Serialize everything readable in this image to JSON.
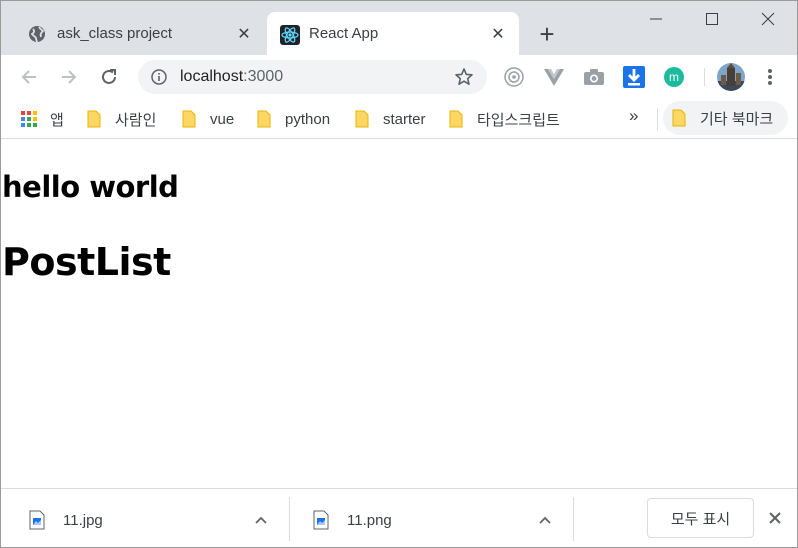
{
  "tabs": [
    {
      "title": "ask_class project",
      "close": "✕"
    },
    {
      "title": "React App",
      "close": "✕"
    }
  ],
  "new_tab": "+",
  "address_bar": {
    "host": "localhost",
    "port": ":3000"
  },
  "bookmarks": [
    {
      "label": "앱"
    },
    {
      "label": "사람인"
    },
    {
      "label": "vue"
    },
    {
      "label": "python"
    },
    {
      "label": "starter"
    },
    {
      "label": "타입스크립트"
    }
  ],
  "bookmarks_overflow": "»",
  "other_bookmarks": "기타 북마크",
  "page": {
    "heading_small": "hello world",
    "heading_large": "PostList"
  },
  "downloads": {
    "items": [
      {
        "filename": "11.jpg"
      },
      {
        "filename": "11.png"
      }
    ],
    "show_all": "모두 표시"
  },
  "colors": {
    "tabstrip": "#dee1e6",
    "react_logo": "#61dafb",
    "download_arrow": "#1a73e8",
    "ext_m": "#1abc9c"
  }
}
